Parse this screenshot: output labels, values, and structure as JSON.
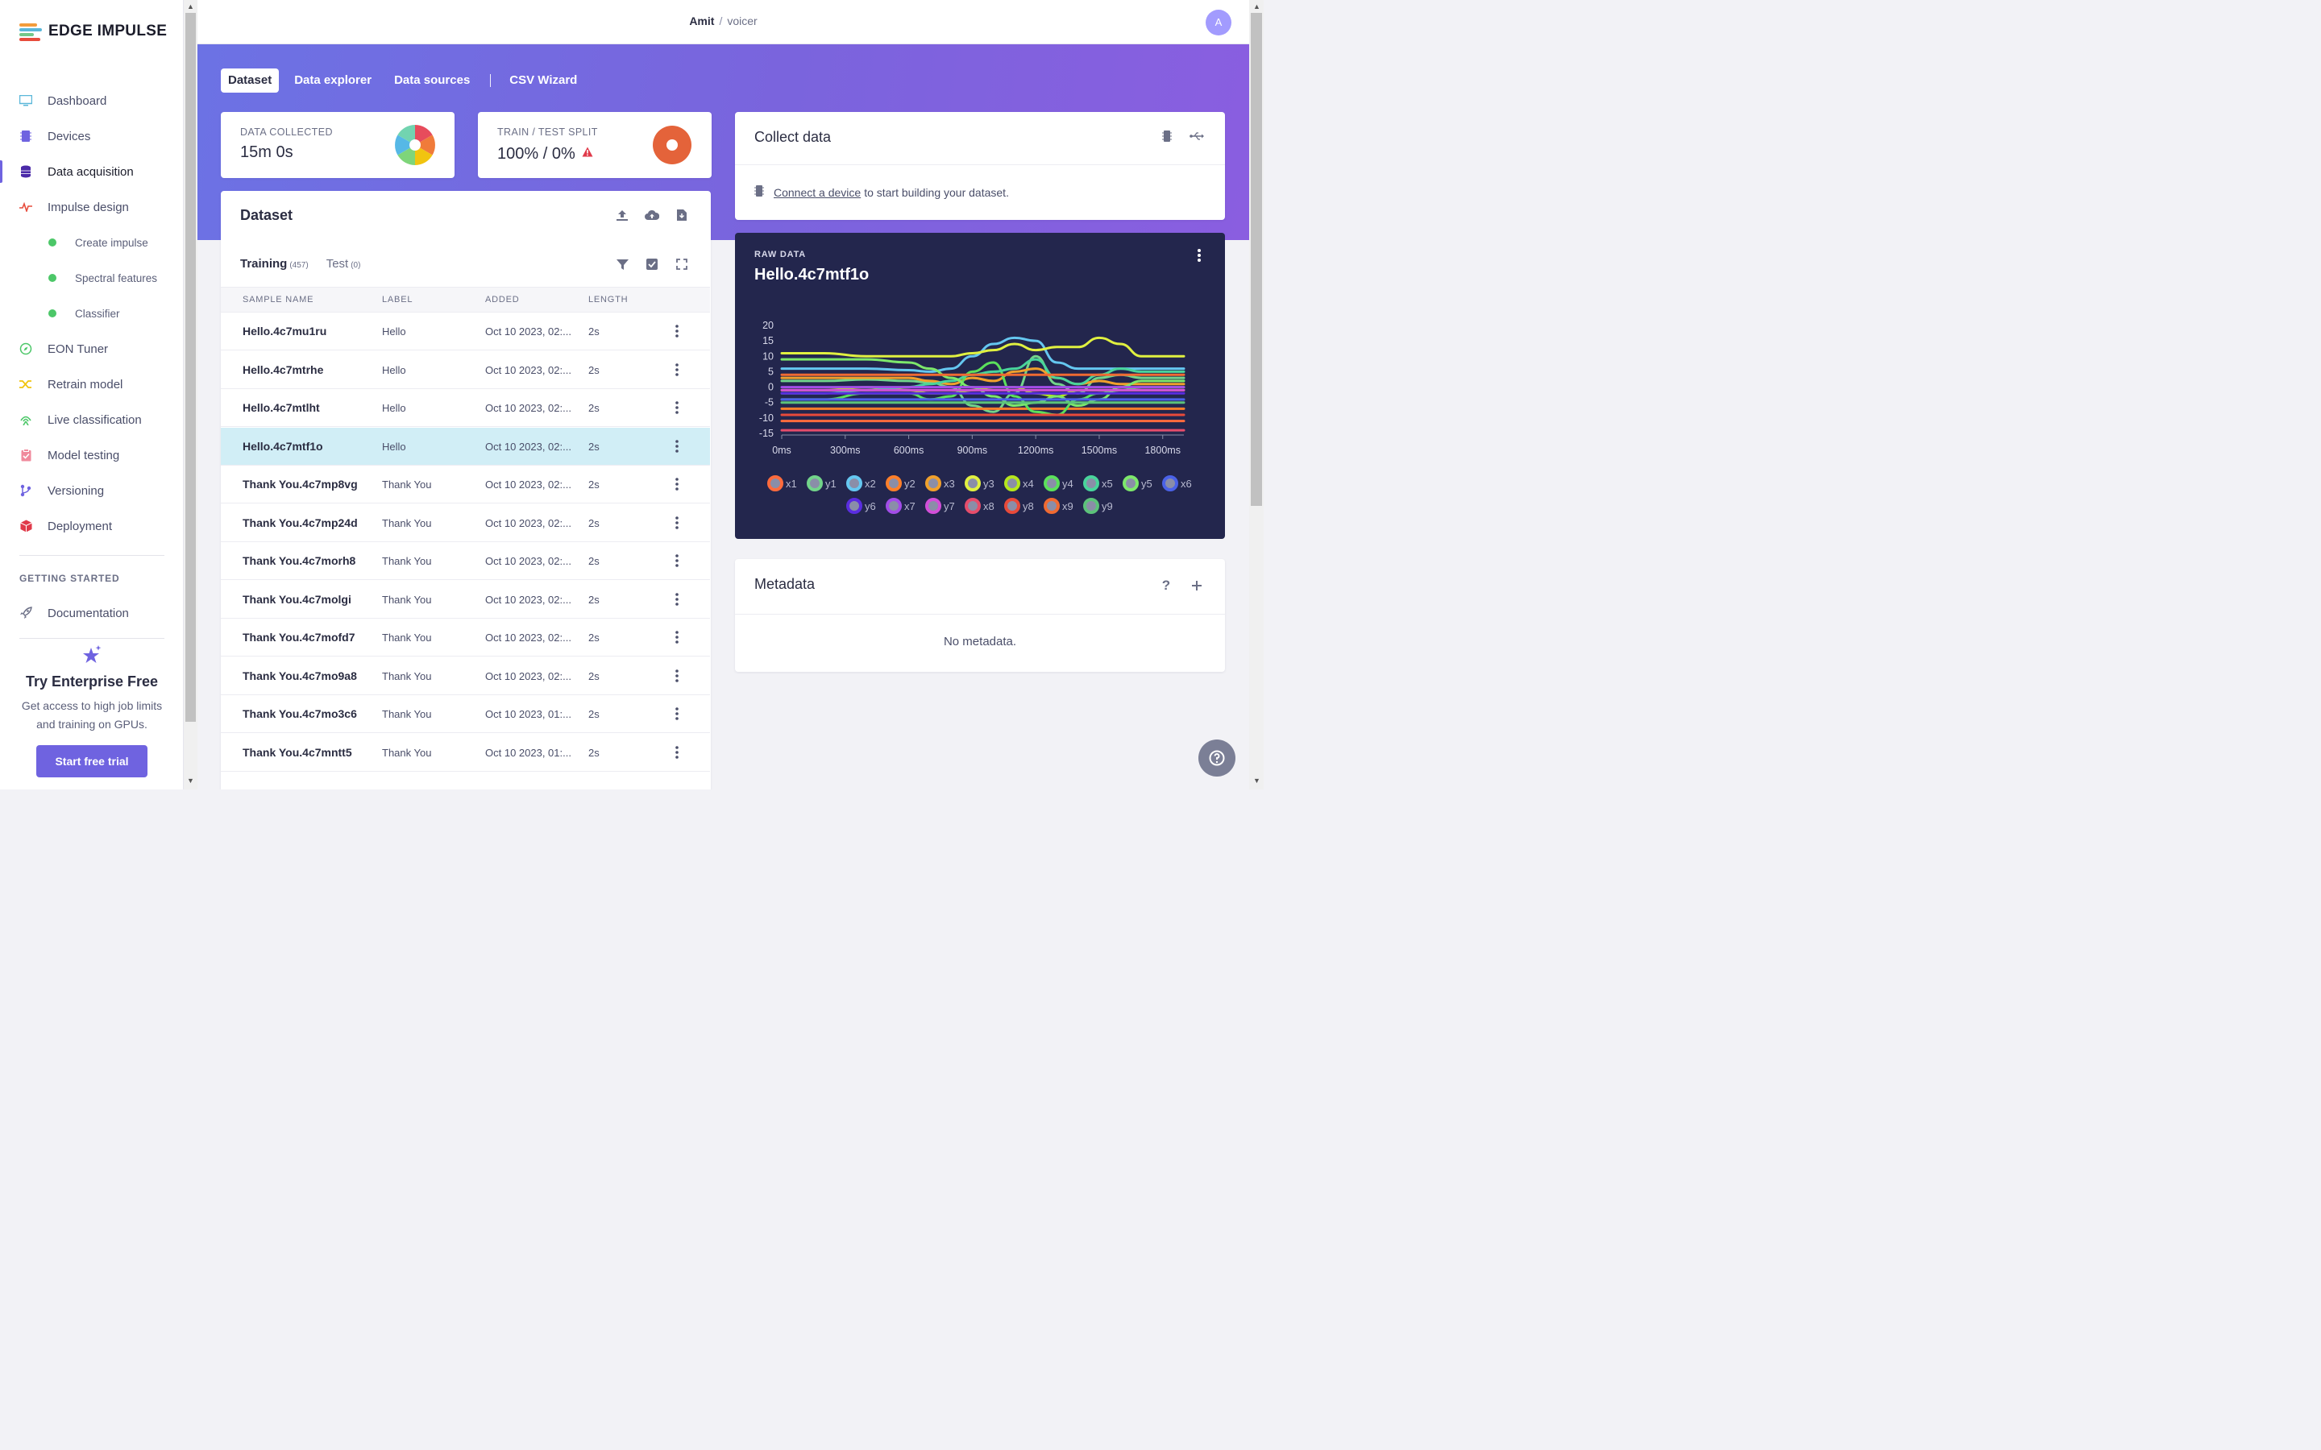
{
  "brand": {
    "name": "EDGE IMPULSE"
  },
  "sidebar": {
    "items": [
      {
        "label": "Dashboard",
        "icon": "monitor-icon"
      },
      {
        "label": "Devices",
        "icon": "chip-icon"
      },
      {
        "label": "Data acquisition",
        "icon": "database-icon"
      },
      {
        "label": "Impulse design",
        "icon": "pulse-icon"
      }
    ],
    "subitems": [
      {
        "label": "Create impulse"
      },
      {
        "label": "Spectral features"
      },
      {
        "label": "Classifier"
      }
    ],
    "items2": [
      {
        "label": "EON Tuner",
        "icon": "compass-icon"
      },
      {
        "label": "Retrain model",
        "icon": "shuffle-icon"
      },
      {
        "label": "Live classification",
        "icon": "live-icon"
      },
      {
        "label": "Model testing",
        "icon": "clipboard-check-icon"
      },
      {
        "label": "Versioning",
        "icon": "branch-icon"
      },
      {
        "label": "Deployment",
        "icon": "box-icon"
      }
    ],
    "section": "GETTING STARTED",
    "documentation": "Documentation",
    "promo": {
      "title": "Try Enterprise Free",
      "text": "Get access to high job limits and training on GPUs.",
      "button": "Start free trial"
    }
  },
  "header": {
    "user": "Amit",
    "separator": "/",
    "project": "voicer",
    "avatar": "A"
  },
  "tabs": [
    "Dataset",
    "Data explorer",
    "Data sources",
    "CSV Wizard"
  ],
  "stats": {
    "collected_label": "DATA COLLECTED",
    "collected_value": "15m 0s",
    "split_label": "TRAIN / TEST SPLIT",
    "split_value": "100% / 0%",
    "train_fraction": 1.0
  },
  "dataset": {
    "title": "Dataset",
    "training_label": "Training",
    "training_count": "(457)",
    "test_label": "Test",
    "test_count": "(0)",
    "columns": [
      "SAMPLE NAME",
      "LABEL",
      "ADDED",
      "LENGTH"
    ],
    "rows": [
      {
        "name": "Hello.4c7mu1ru",
        "label": "Hello",
        "added": "Oct 10 2023, 02:...",
        "length": "2s"
      },
      {
        "name": "Hello.4c7mtrhe",
        "label": "Hello",
        "added": "Oct 10 2023, 02:...",
        "length": "2s"
      },
      {
        "name": "Hello.4c7mtlht",
        "label": "Hello",
        "added": "Oct 10 2023, 02:...",
        "length": "2s"
      },
      {
        "name": "Hello.4c7mtf1o",
        "label": "Hello",
        "added": "Oct 10 2023, 02:...",
        "length": "2s",
        "selected": true
      },
      {
        "name": "Thank You.4c7mp8vg",
        "label": "Thank You",
        "added": "Oct 10 2023, 02:...",
        "length": "2s"
      },
      {
        "name": "Thank You.4c7mp24d",
        "label": "Thank You",
        "added": "Oct 10 2023, 02:...",
        "length": "2s"
      },
      {
        "name": "Thank You.4c7morh8",
        "label": "Thank You",
        "added": "Oct 10 2023, 02:...",
        "length": "2s"
      },
      {
        "name": "Thank You.4c7molgi",
        "label": "Thank You",
        "added": "Oct 10 2023, 02:...",
        "length": "2s"
      },
      {
        "name": "Thank You.4c7mofd7",
        "label": "Thank You",
        "added": "Oct 10 2023, 02:...",
        "length": "2s"
      },
      {
        "name": "Thank You.4c7mo9a8",
        "label": "Thank You",
        "added": "Oct 10 2023, 02:...",
        "length": "2s"
      },
      {
        "name": "Thank You.4c7mo3c6",
        "label": "Thank You",
        "added": "Oct 10 2023, 01:...",
        "length": "2s"
      },
      {
        "name": "Thank You.4c7mntt5",
        "label": "Thank You",
        "added": "Oct 10 2023, 01:...",
        "length": "2s"
      }
    ]
  },
  "collect": {
    "title": "Collect data",
    "link": "Connect a device",
    "text": "to start building your dataset."
  },
  "raw": {
    "label": "RAW DATA",
    "title": "Hello.4c7mtf1o"
  },
  "metadata": {
    "title": "Metadata",
    "empty": "No metadata."
  },
  "chart_data": {
    "type": "line",
    "x_unit": "ms",
    "x_ticks": [
      "0ms",
      "300ms",
      "600ms",
      "900ms",
      "1200ms",
      "1500ms",
      "1800ms"
    ],
    "xlim": [
      0,
      1900
    ],
    "y_ticks": [
      "20",
      "15",
      "10",
      "5",
      "0",
      "-5",
      "-10",
      "-15"
    ],
    "ylim": [
      -15,
      20
    ],
    "x": [
      0,
      200,
      400,
      600,
      700,
      800,
      900,
      1000,
      1100,
      1200,
      1300,
      1400,
      1500,
      1600,
      1700,
      1900
    ],
    "series": [
      {
        "name": "x1",
        "color": "#ff6b3d",
        "values": [
          -11,
          -11,
          -11,
          -11,
          -11,
          -11,
          -11,
          -11,
          -11,
          -11,
          -11,
          -11,
          -11,
          -11,
          -11,
          -11
        ]
      },
      {
        "name": "y1",
        "color": "#72d48a",
        "values": [
          2,
          2,
          2.5,
          2,
          1.5,
          0,
          -6,
          -8,
          -2,
          10,
          1,
          -2,
          3,
          4,
          3,
          3
        ]
      },
      {
        "name": "x2",
        "color": "#65c7f0",
        "values": [
          6,
          6,
          6,
          5.5,
          5,
          6,
          10,
          14,
          16,
          15,
          8,
          6,
          6,
          6,
          6,
          6
        ]
      },
      {
        "name": "y2",
        "color": "#ff7f2a",
        "values": [
          -7,
          -7,
          -7,
          -7,
          -7,
          -7,
          -7,
          -7,
          -7,
          -7,
          -7,
          -7,
          -7,
          -7,
          -7,
          -7
        ]
      },
      {
        "name": "x3",
        "color": "#f0a02c",
        "values": [
          3,
          3,
          3,
          3,
          2,
          1,
          3,
          2,
          5,
          6,
          3,
          1,
          2,
          1,
          1,
          1
        ]
      },
      {
        "name": "y3",
        "color": "#e0f040",
        "values": [
          11,
          11,
          10,
          10,
          10,
          10,
          11,
          12,
          14,
          12,
          13,
          13,
          16,
          14,
          10,
          10
        ]
      },
      {
        "name": "x4",
        "color": "#b5e61d",
        "values": [
          -1,
          -1,
          0,
          -1,
          -2,
          -2,
          -1,
          0,
          0,
          -2,
          -3,
          -1,
          -1,
          -1,
          -1,
          -1
        ]
      },
      {
        "name": "y4",
        "color": "#5be05b",
        "values": [
          -4,
          -4,
          -2,
          -2,
          -4,
          -3,
          5,
          8,
          -3,
          -8,
          -9,
          -4,
          -2,
          -1,
          0,
          0
        ]
      },
      {
        "name": "x5",
        "color": "#49d49b",
        "values": [
          -2,
          -2,
          -1,
          0,
          1,
          2,
          4,
          5,
          6,
          9,
          3,
          1,
          4,
          6,
          5,
          5
        ]
      },
      {
        "name": "y5",
        "color": "#7de86b",
        "values": [
          9,
          9,
          9,
          8,
          6,
          3,
          0,
          -3,
          -6,
          -5,
          -3,
          -6,
          -4,
          0,
          2,
          2
        ]
      },
      {
        "name": "x6",
        "color": "#4b62e8",
        "values": [
          -4,
          -4,
          -4,
          -4,
          -4,
          -4,
          -4,
          -4,
          -4,
          -4,
          -4,
          -4,
          -4,
          -4,
          -4,
          -4
        ]
      },
      {
        "name": "y6",
        "color": "#5a2de0",
        "values": [
          -2,
          -2,
          -2,
          -2,
          -2,
          -2,
          -2,
          -2,
          -2,
          -2,
          -2,
          -2,
          -2,
          -2,
          -2,
          -2
        ]
      },
      {
        "name": "x7",
        "color": "#a24de8",
        "values": [
          0,
          0,
          0,
          0,
          0,
          0,
          0,
          0,
          0,
          0,
          0,
          0,
          0,
          0,
          0,
          0
        ]
      },
      {
        "name": "y7",
        "color": "#d24fd8",
        "values": [
          -1,
          -1,
          -1,
          -1,
          -1,
          -1,
          -1,
          -1,
          -1,
          -1,
          -1,
          -1,
          -1,
          -1,
          -1,
          -1
        ]
      },
      {
        "name": "x8",
        "color": "#e64d6b",
        "values": [
          -14,
          -14,
          -14,
          -14,
          -14,
          -14,
          -14,
          -14,
          -14,
          -14,
          -14,
          -14,
          -14,
          -14,
          -14,
          -14
        ]
      },
      {
        "name": "y8",
        "color": "#e84a3a",
        "values": [
          -9,
          -9,
          -9,
          -9,
          -9,
          -9,
          -9,
          -9,
          -9,
          -9,
          -9,
          -9,
          -9,
          -9,
          -9,
          -9
        ]
      },
      {
        "name": "x9",
        "color": "#f06a32",
        "values": [
          4,
          4,
          4,
          4,
          4,
          4,
          4,
          4,
          4,
          4,
          4,
          4,
          4,
          4,
          4,
          4
        ]
      },
      {
        "name": "y9",
        "color": "#5cc27a",
        "values": [
          -5,
          -5,
          -5,
          -5,
          -5,
          -5,
          -5,
          -5,
          -5,
          -5,
          -5,
          -5,
          -5,
          -5,
          -5,
          -5
        ]
      }
    ]
  }
}
